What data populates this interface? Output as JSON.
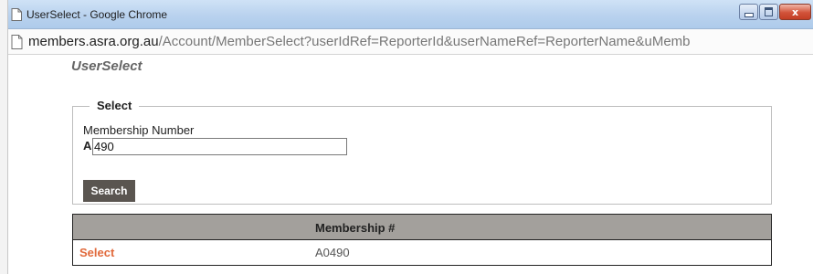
{
  "window": {
    "title": "UserSelect - Google Chrome",
    "controls": {
      "minimize_icon": "minimize-icon",
      "maximize_icon": "maximize-icon",
      "close_icon": "close-icon",
      "close_glyph": "x"
    }
  },
  "address_bar": {
    "host": "members.asra.org.au",
    "path": "/Account/MemberSelect?userIdRef=ReporterId&userNameRef=ReporterName&uMemb",
    "icon": "page-icon"
  },
  "page": {
    "heading": "UserSelect",
    "form": {
      "legend": "Select",
      "membership_label": "Membership Number",
      "prefix": "A",
      "membership_value": "490",
      "search_label": "Search"
    },
    "results": {
      "columns": [
        "",
        "Membership #"
      ],
      "rows": [
        {
          "action": "Select",
          "membership": "A0490"
        }
      ]
    }
  },
  "colors": {
    "titlebar": "#b9d2ee",
    "button_bg": "#5a5550",
    "table_header": "#a3a09c",
    "select_link": "#e16a3c"
  }
}
